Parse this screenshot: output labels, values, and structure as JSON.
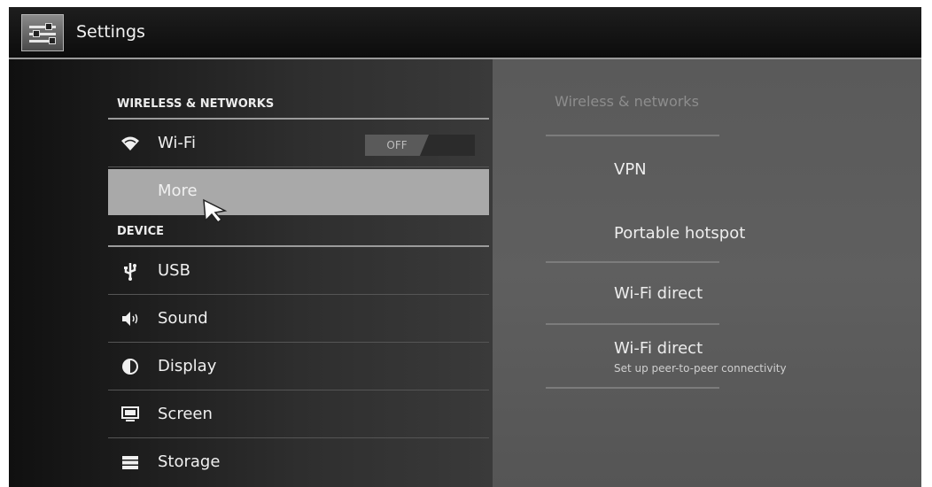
{
  "app": {
    "title": "Settings",
    "icon": "settings-sliders-icon"
  },
  "left": {
    "wireless_header": "WIRELESS & NETWORKS",
    "wifi": {
      "label": "Wi-Fi",
      "icon": "wifi-icon",
      "toggle": "OFF"
    },
    "more": {
      "label": "More"
    },
    "device_header": "DEVICE",
    "device_items": [
      {
        "label": "USB",
        "icon": "usb-icon"
      },
      {
        "label": "Sound",
        "icon": "speaker-icon"
      },
      {
        "label": "Display",
        "icon": "display-brightness-icon"
      },
      {
        "label": "Screen",
        "icon": "monitor-icon"
      },
      {
        "label": "Storage",
        "icon": "storage-icon"
      }
    ]
  },
  "right": {
    "header": "Wireless & networks",
    "items": [
      {
        "label": "VPN"
      },
      {
        "label": "Portable hotspot"
      },
      {
        "label": "Wi-Fi direct"
      },
      {
        "label": "Wi-Fi direct",
        "sub": "Set up peer-to-peer connectivity"
      }
    ]
  },
  "colors": {
    "selected_row": "#a9a9a9",
    "background": "#111111",
    "detail_pane": "#5c5c5c"
  }
}
